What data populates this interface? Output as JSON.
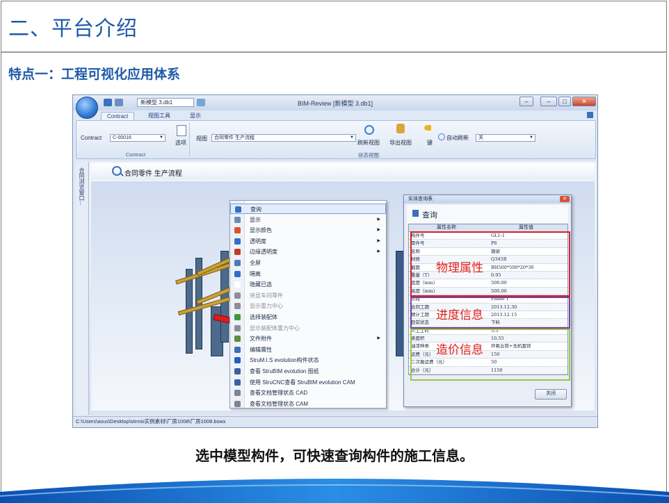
{
  "slide": {
    "title": "二、平台介绍",
    "subtitle": "特点一：工程可视化应用体系",
    "caption": "选中模型构件，可快速查询构件的施工信息。"
  },
  "window": {
    "doc_name": "新模型 3.db1",
    "title": "BIM-Review [新模型 3.db1]",
    "tabs": [
      "Contract",
      "视图工具",
      "显示"
    ],
    "active_tab": "Contract"
  },
  "ribbon": {
    "contract_label": "Contract",
    "contract_value": "C-00016",
    "options_label": "选项",
    "contract_group": "Contract",
    "view_label": "视图",
    "view_value": "合同零件 生产流程",
    "refresh_view": "刷新视图",
    "export_view": "导出视图",
    "key_label": "键",
    "auto_refresh_label": "自动刷新",
    "auto_refresh_value": "关",
    "status_view_group": "状态视图"
  },
  "sidebar": {
    "label": "合同浏览窗口..."
  },
  "view": {
    "title": "合同零件 生产流程"
  },
  "context_menu": {
    "items": [
      {
        "label": "查询",
        "submenu": false,
        "disabled": false,
        "highlight": true,
        "color": "#2f6fc7"
      },
      {
        "label": "显示",
        "submenu": true,
        "disabled": false,
        "highlight": false,
        "color": "#6d8ab8"
      },
      {
        "label": "显示颜色",
        "submenu": true,
        "disabled": false,
        "highlight": false,
        "color": "#d9532b"
      },
      {
        "label": "透明度",
        "submenu": true,
        "disabled": false,
        "highlight": false,
        "color": "#2f6fc7"
      },
      {
        "label": "边缘透明度",
        "submenu": true,
        "disabled": false,
        "highlight": false,
        "color": "#c33b2b"
      },
      {
        "label": "全屏",
        "submenu": false,
        "disabled": false,
        "highlight": false,
        "color": "#4e79b9"
      },
      {
        "label": "隔离",
        "submenu": false,
        "disabled": false,
        "highlight": false,
        "color": "#2f6fc7"
      },
      {
        "label": "隐藏已选",
        "submenu": false,
        "disabled": false,
        "highlight": false,
        "color": "#ffffff"
      },
      {
        "label": "突显车间零件",
        "submenu": false,
        "disabled": true,
        "highlight": false,
        "color": "#8a8f99"
      },
      {
        "label": "显示重力中心",
        "submenu": false,
        "disabled": true,
        "highlight": false,
        "color": "#8a8f99"
      },
      {
        "label": "选择装配体",
        "submenu": false,
        "disabled": false,
        "highlight": false,
        "color": "#3a9b3a"
      },
      {
        "label": "显示装配体重力中心",
        "submenu": false,
        "disabled": true,
        "highlight": false,
        "color": "#8a8f99"
      },
      {
        "label": "文件附件",
        "submenu": true,
        "disabled": false,
        "highlight": false,
        "color": "#5b8f3e"
      },
      {
        "label": "编辑属性",
        "submenu": false,
        "disabled": false,
        "highlight": false,
        "color": "#3d6fb8"
      },
      {
        "label": "StruM.I.S evolution构件状态",
        "submenu": false,
        "disabled": false,
        "highlight": false,
        "color": "#1f5fc0"
      },
      {
        "label": "查看 StruBIM evolution 图纸",
        "submenu": false,
        "disabled": false,
        "highlight": false,
        "color": "#3a5fa0"
      },
      {
        "label": "使用 StruCNC查看 StruBIM evolution CAM",
        "submenu": false,
        "disabled": false,
        "highlight": false,
        "color": "#3a5fa0"
      },
      {
        "label": "查看文档管理状态 CAD",
        "submenu": false,
        "disabled": false,
        "highlight": false,
        "color": "#7b8594"
      },
      {
        "label": "查看文档管理状态 CAM",
        "submenu": false,
        "disabled": false,
        "highlight": false,
        "color": "#7b8594"
      }
    ]
  },
  "dialog": {
    "window_title": "实体查询表",
    "header": "查询",
    "col_name": "属性名称",
    "col_value": "属性值",
    "rows": [
      {
        "k": "构件号",
        "v": "GL1-1"
      },
      {
        "k": "零件号",
        "v": "P6"
      },
      {
        "k": "名称",
        "v": "钢梁"
      },
      {
        "k": "材质",
        "v": "Q345B"
      },
      {
        "k": "截面",
        "v": "BH500*500*20*30"
      },
      {
        "k": "重量（T）",
        "v": "0.95"
      },
      {
        "k": "宽度（mm）",
        "v": "500.00"
      },
      {
        "k": "高度（mm）",
        "v": "500.00"
      },
      {
        "k": "阶段",
        "v": "Phase 1"
      },
      {
        "k": "合同工期",
        "v": "2013.12.30"
      },
      {
        "k": "预计工期",
        "v": "2013.12.15"
      },
      {
        "k": "目前状态",
        "v": "下料"
      },
      {
        "k": "人工工时",
        "v": "3.5"
      },
      {
        "k": "表面积",
        "v": "10.55"
      },
      {
        "k": "油漆种类",
        "v": "环氧云铁+无机富锌"
      },
      {
        "k": "运费（元）",
        "v": "150"
      },
      {
        "k": "二次搬运费（元）",
        "v": "50"
      },
      {
        "k": "合计（元）",
        "v": "1150"
      }
    ],
    "close_button": "关闭"
  },
  "annotations": {
    "physical": "物理属性",
    "progress": "进度信息",
    "cost": "造价信息",
    "colors": {
      "physical": "#d4202a",
      "progress": "#7b3f9e",
      "cost": "#9ac44a",
      "text": "#e0201c"
    }
  },
  "statusbar": {
    "path": "C:\\Users\\asus\\Desktop\\strmis实例素材\\厂房1008\\厂房1008.bswx"
  }
}
